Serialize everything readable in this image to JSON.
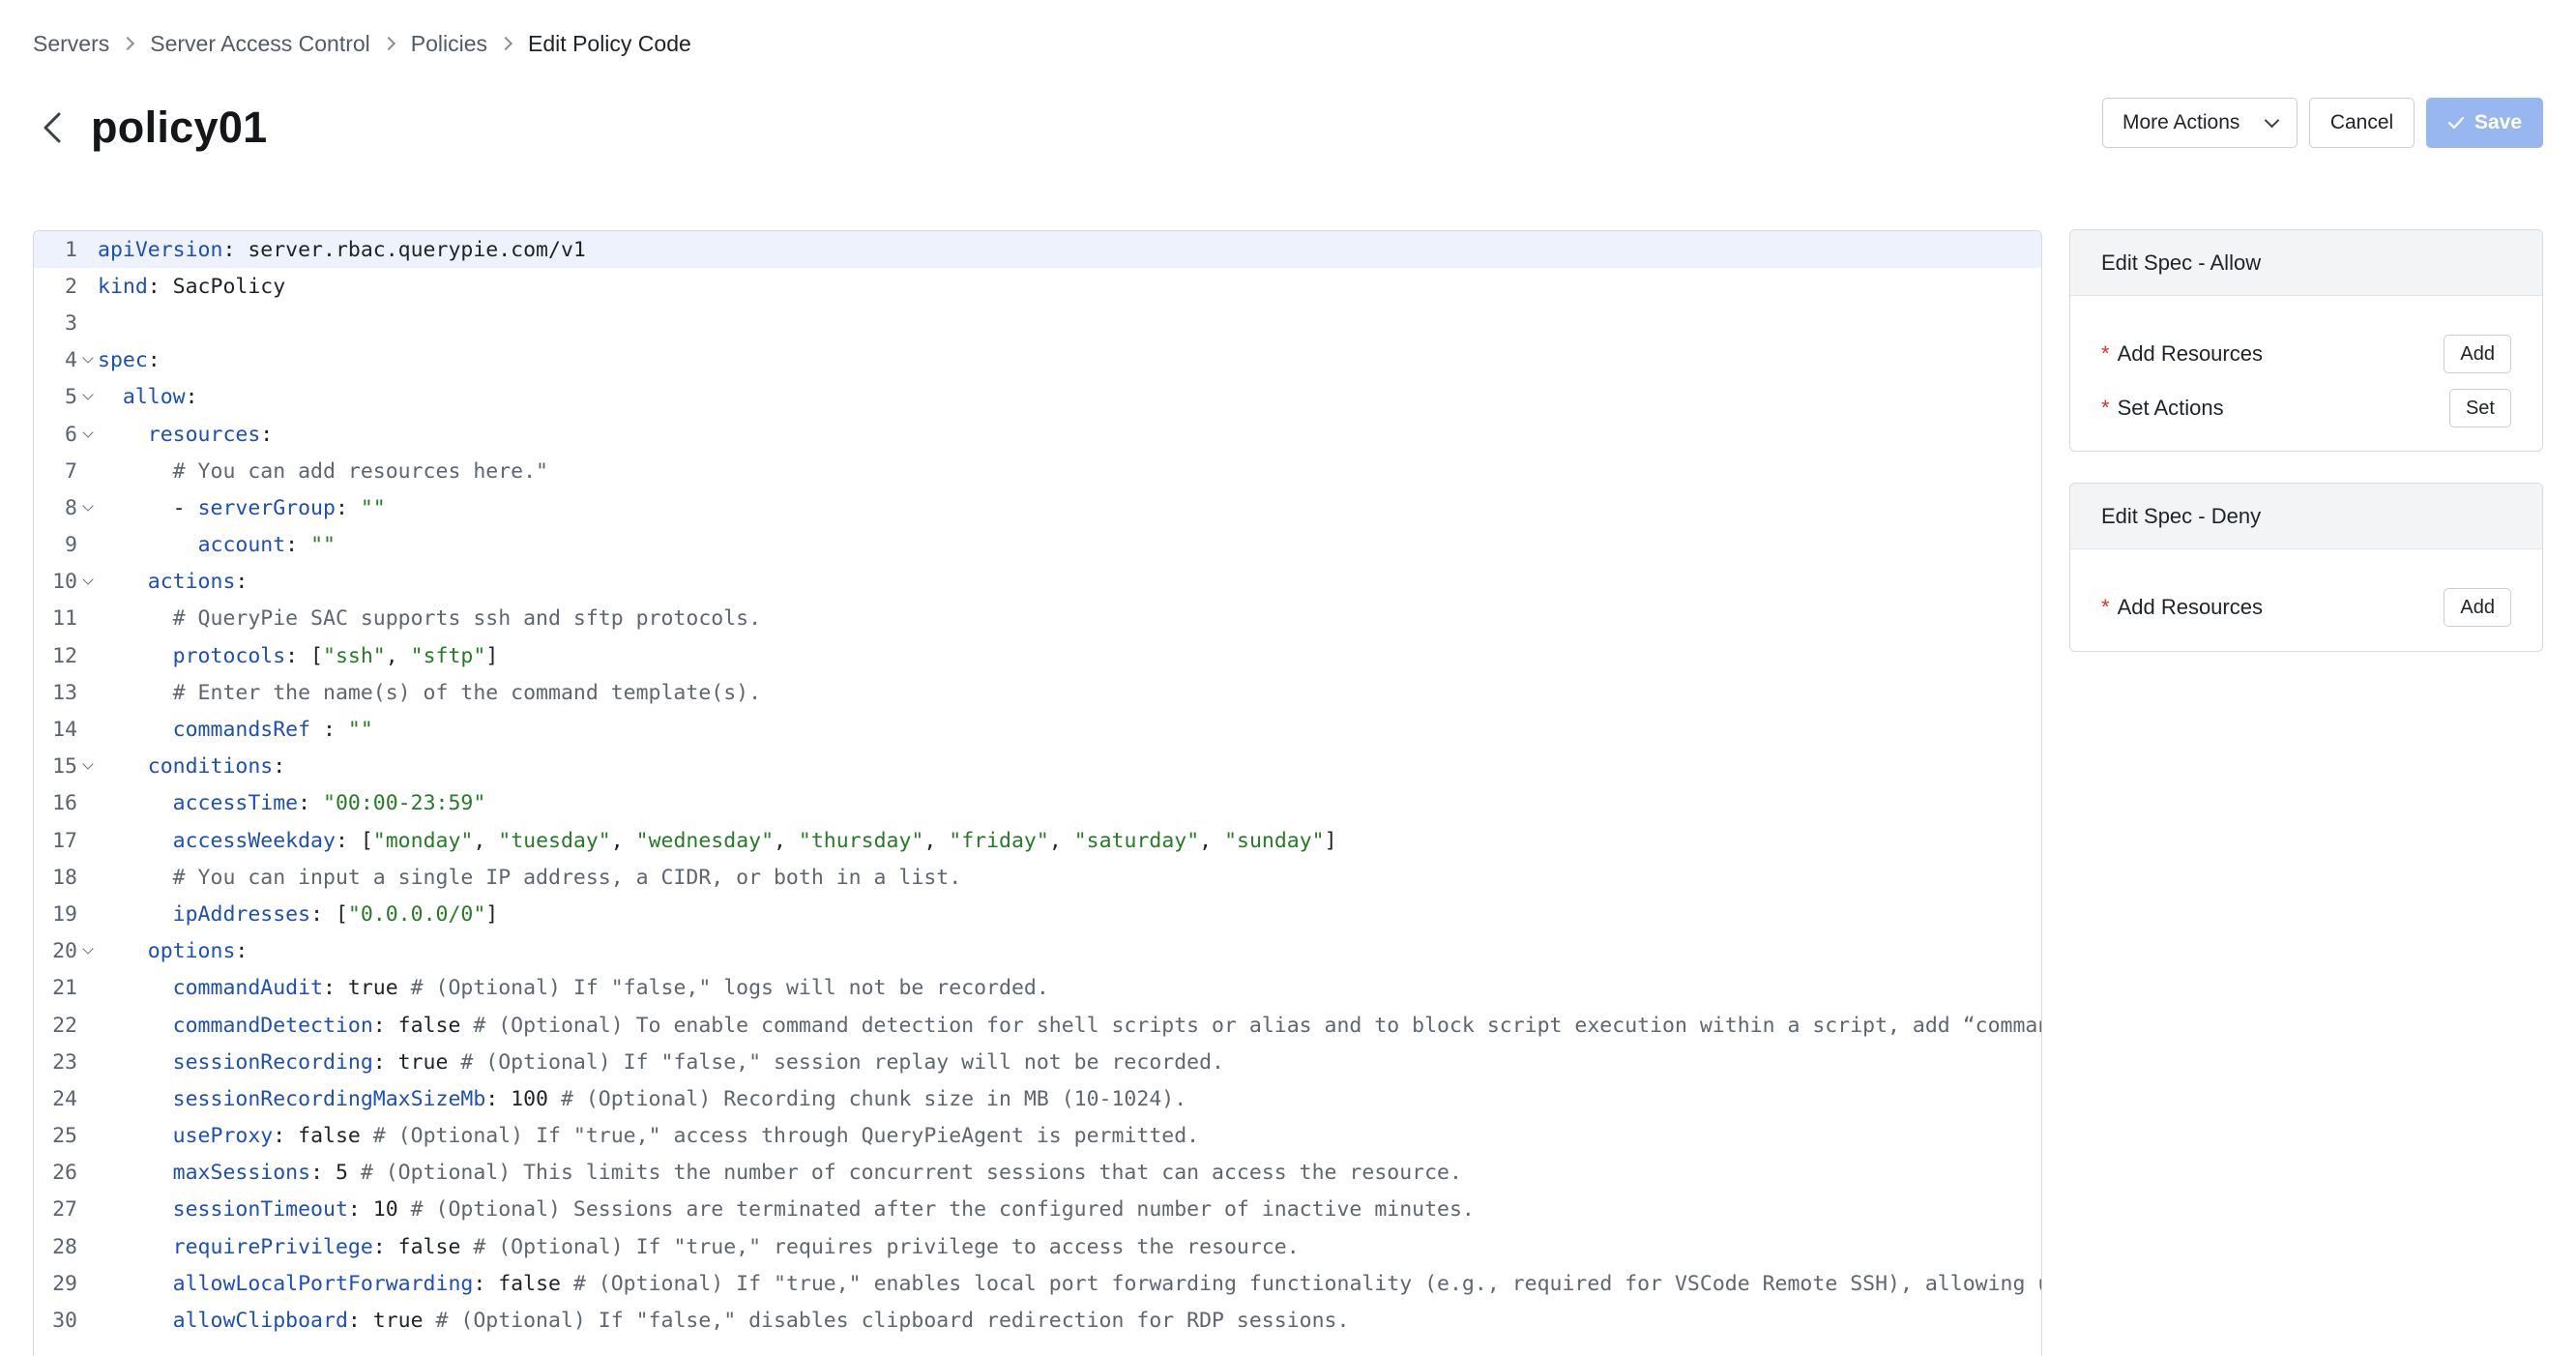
{
  "breadcrumb": [
    "Servers",
    "Server Access Control",
    "Policies",
    "Edit Policy Code"
  ],
  "page": {
    "title": "policy01"
  },
  "actions": {
    "more_label": "More Actions",
    "cancel_label": "Cancel",
    "save_label": "Save"
  },
  "colors": {
    "keyword": "#1d4fb8",
    "string": "#267c25",
    "comment": "#5f6670",
    "save_button": "#98b7f0",
    "required_star": "#e03131",
    "active_line": "#edf2fd"
  },
  "editor": {
    "lines": [
      {
        "n": "1",
        "fold": false,
        "indent": "",
        "parts": [
          [
            "k",
            "apiVersion"
          ],
          [
            "p",
            ": server.rbac.querypie.com/v1"
          ]
        ]
      },
      {
        "n": "2",
        "fold": false,
        "indent": "",
        "parts": [
          [
            "k",
            "kind"
          ],
          [
            "p",
            ": SacPolicy"
          ]
        ]
      },
      {
        "n": "3",
        "fold": false,
        "indent": "",
        "parts": []
      },
      {
        "n": "4",
        "fold": true,
        "indent": "",
        "parts": [
          [
            "k",
            "spec"
          ],
          [
            "p",
            ":"
          ]
        ]
      },
      {
        "n": "5",
        "fold": true,
        "indent": "  ",
        "parts": [
          [
            "k",
            "allow"
          ],
          [
            "p",
            ":"
          ]
        ]
      },
      {
        "n": "6",
        "fold": true,
        "indent": "    ",
        "parts": [
          [
            "k",
            "resources"
          ],
          [
            "p",
            ":"
          ]
        ]
      },
      {
        "n": "7",
        "fold": false,
        "indent": "      ",
        "parts": [
          [
            "c",
            "# You can add resources here.\""
          ]
        ]
      },
      {
        "n": "8",
        "fold": true,
        "indent": "      ",
        "parts": [
          [
            "p",
            "- "
          ],
          [
            "k",
            "serverGroup"
          ],
          [
            "p",
            ": "
          ],
          [
            "s",
            "\"\""
          ]
        ]
      },
      {
        "n": "9",
        "fold": false,
        "indent": "        ",
        "parts": [
          [
            "k",
            "account"
          ],
          [
            "p",
            ": "
          ],
          [
            "s",
            "\"\""
          ]
        ]
      },
      {
        "n": "10",
        "fold": true,
        "indent": "    ",
        "parts": [
          [
            "k",
            "actions"
          ],
          [
            "p",
            ":"
          ]
        ]
      },
      {
        "n": "11",
        "fold": false,
        "indent": "      ",
        "parts": [
          [
            "c",
            "# QueryPie SAC supports ssh and sftp protocols."
          ]
        ]
      },
      {
        "n": "12",
        "fold": false,
        "indent": "      ",
        "parts": [
          [
            "k",
            "protocols"
          ],
          [
            "p",
            ": ["
          ],
          [
            "s",
            "\"ssh\""
          ],
          [
            "p",
            ", "
          ],
          [
            "s",
            "\"sftp\""
          ],
          [
            "p",
            "]"
          ]
        ]
      },
      {
        "n": "13",
        "fold": false,
        "indent": "      ",
        "parts": [
          [
            "c",
            "# Enter the name(s) of the command template(s)."
          ]
        ]
      },
      {
        "n": "14",
        "fold": false,
        "indent": "      ",
        "parts": [
          [
            "k",
            "commandsRef"
          ],
          [
            "p",
            " : "
          ],
          [
            "s",
            "\"\""
          ]
        ]
      },
      {
        "n": "15",
        "fold": true,
        "indent": "    ",
        "parts": [
          [
            "k",
            "conditions"
          ],
          [
            "p",
            ":"
          ]
        ]
      },
      {
        "n": "16",
        "fold": false,
        "indent": "      ",
        "parts": [
          [
            "k",
            "accessTime"
          ],
          [
            "p",
            ": "
          ],
          [
            "s",
            "\"00:00-23:59\""
          ]
        ]
      },
      {
        "n": "17",
        "fold": false,
        "indent": "      ",
        "parts": [
          [
            "k",
            "accessWeekday"
          ],
          [
            "p",
            ": ["
          ],
          [
            "s",
            "\"monday\""
          ],
          [
            "p",
            ", "
          ],
          [
            "s",
            "\"tuesday\""
          ],
          [
            "p",
            ", "
          ],
          [
            "s",
            "\"wednesday\""
          ],
          [
            "p",
            ", "
          ],
          [
            "s",
            "\"thursday\""
          ],
          [
            "p",
            ", "
          ],
          [
            "s",
            "\"friday\""
          ],
          [
            "p",
            ", "
          ],
          [
            "s",
            "\"saturday\""
          ],
          [
            "p",
            ", "
          ],
          [
            "s",
            "\"sunday\""
          ],
          [
            "p",
            "]"
          ]
        ]
      },
      {
        "n": "18",
        "fold": false,
        "indent": "      ",
        "parts": [
          [
            "c",
            "# You can input a single IP address, a CIDR, or both in a list."
          ]
        ]
      },
      {
        "n": "19",
        "fold": false,
        "indent": "      ",
        "parts": [
          [
            "k",
            "ipAddresses"
          ],
          [
            "p",
            ": ["
          ],
          [
            "s",
            "\"0.0.0.0/0\""
          ],
          [
            "p",
            "]"
          ]
        ]
      },
      {
        "n": "20",
        "fold": true,
        "indent": "    ",
        "parts": [
          [
            "k",
            "options"
          ],
          [
            "p",
            ":"
          ]
        ]
      },
      {
        "n": "21",
        "fold": false,
        "indent": "      ",
        "parts": [
          [
            "k",
            "commandAudit"
          ],
          [
            "p",
            ": true "
          ],
          [
            "c",
            "# (Optional) If \"false,\" logs will not be recorded."
          ]
        ]
      },
      {
        "n": "22",
        "fold": false,
        "indent": "      ",
        "parts": [
          [
            "k",
            "commandDetection"
          ],
          [
            "p",
            ": false "
          ],
          [
            "c",
            "# (Optional) To enable command detection for shell scripts or alias and to block script execution within a script, add “commandD"
          ]
        ]
      },
      {
        "n": "23",
        "fold": false,
        "indent": "      ",
        "parts": [
          [
            "k",
            "sessionRecording"
          ],
          [
            "p",
            ": true "
          ],
          [
            "c",
            "# (Optional) If \"false,\" session replay will not be recorded."
          ]
        ]
      },
      {
        "n": "24",
        "fold": false,
        "indent": "      ",
        "parts": [
          [
            "k",
            "sessionRecordingMaxSizeMb"
          ],
          [
            "p",
            ": 100 "
          ],
          [
            "c",
            "# (Optional) Recording chunk size in MB (10-1024)."
          ]
        ]
      },
      {
        "n": "25",
        "fold": false,
        "indent": "      ",
        "parts": [
          [
            "k",
            "useProxy"
          ],
          [
            "p",
            ": false "
          ],
          [
            "c",
            "# (Optional) If \"true,\" access through QueryPieAgent is permitted."
          ]
        ]
      },
      {
        "n": "26",
        "fold": false,
        "indent": "      ",
        "parts": [
          [
            "k",
            "maxSessions"
          ],
          [
            "p",
            ": 5 "
          ],
          [
            "c",
            "# (Optional) This limits the number of concurrent sessions that can access the resource."
          ]
        ]
      },
      {
        "n": "27",
        "fold": false,
        "indent": "      ",
        "parts": [
          [
            "k",
            "sessionTimeout"
          ],
          [
            "p",
            ": 10 "
          ],
          [
            "c",
            "# (Optional) Sessions are terminated after the configured number of inactive minutes."
          ]
        ]
      },
      {
        "n": "28",
        "fold": false,
        "indent": "      ",
        "parts": [
          [
            "k",
            "requirePrivilege"
          ],
          [
            "p",
            ": false "
          ],
          [
            "c",
            "# (Optional) If \"true,\" requires privilege to access the resource."
          ]
        ]
      },
      {
        "n": "29",
        "fold": false,
        "indent": "      ",
        "parts": [
          [
            "k",
            "allowLocalPortForwarding"
          ],
          [
            "p",
            ": false "
          ],
          [
            "c",
            "# (Optional) If \"true,\" enables local port forwarding functionality (e.g., required for VSCode Remote SSH), allowing use"
          ]
        ]
      },
      {
        "n": "30",
        "fold": false,
        "indent": "      ",
        "parts": [
          [
            "k",
            "allowClipboard"
          ],
          [
            "p",
            ": true "
          ],
          [
            "c",
            "# (Optional) If \"false,\" disables clipboard redirection for RDP sessions."
          ]
        ]
      }
    ]
  },
  "spec_allow": {
    "title": "Edit Spec - Allow",
    "rows": [
      {
        "label": "Add Resources",
        "button": "Add"
      },
      {
        "label": "Set Actions",
        "button": "Set"
      }
    ]
  },
  "spec_deny": {
    "title": "Edit Spec - Deny",
    "rows": [
      {
        "label": "Add Resources",
        "button": "Add"
      }
    ]
  }
}
